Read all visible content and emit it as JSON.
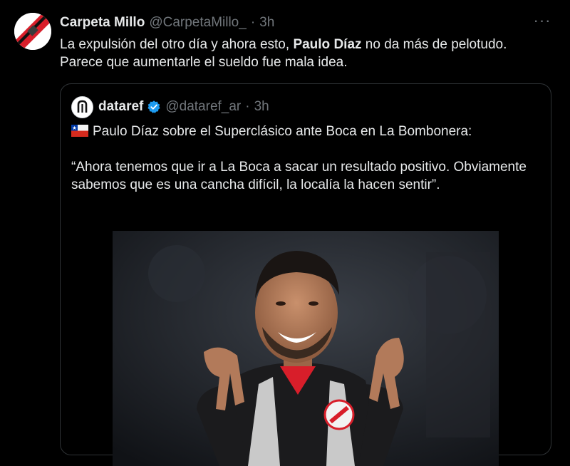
{
  "tweet": {
    "avatar_icon": "river-plate-stripe-avatar",
    "display_name": "Carpeta Millo",
    "handle": "@CarpetaMillo_",
    "separator": "·",
    "time": "3h",
    "more_icon": "more-horizontal-icon",
    "more_label": "···",
    "text_part1": "La expulsión del otro día y ahora esto, ",
    "text_bold": "Paulo Díaz",
    "text_part2": " no da más de pelotudo. Parece que aumentarle el sueldo fue mala idea."
  },
  "quote": {
    "avatar_icon": "dataref-logo-avatar",
    "display_name": "dataref",
    "verified_icon": "verified-badge-icon",
    "handle": "@dataref_ar",
    "separator": "·",
    "time": "3h",
    "flag_icon": "chile-flag-icon",
    "line1": "Paulo Díaz sobre el Superclásico ante Boca en La Bombonera:",
    "quote_text": "“Ahora tenemos que ir a La Boca a sacar un resultado positivo. Obviamente sabemos que es una cancha difícil, la localía la hacen sentir”.",
    "image": "photo-player-celebrating"
  },
  "colors": {
    "background": "#000000",
    "text": "#e7e9ea",
    "muted": "#71767b",
    "border": "#2f3336",
    "verified": "#1d9bf0",
    "accent_red": "#d81e2a"
  }
}
